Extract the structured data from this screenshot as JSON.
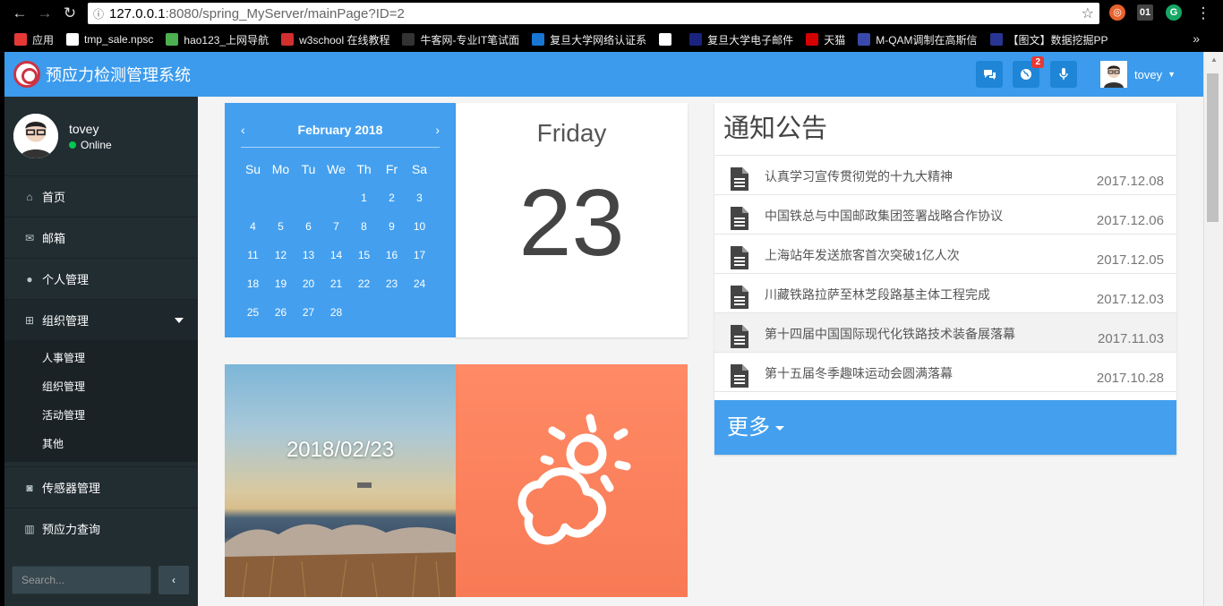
{
  "browser": {
    "url_host": "127.0.0.1",
    "url_rest": ":8080/spring_MyServer/mainPage?ID=2",
    "bookmarks": [
      {
        "label": "应用",
        "color": "#e53935"
      },
      {
        "label": "tmp_sale.npsc",
        "color": "#ffffff"
      },
      {
        "label": "hao123_上网导航",
        "color": "#4caf50"
      },
      {
        "label": "w3school 在线教程",
        "color": "#d32f2f"
      },
      {
        "label": "牛客网-专业IT笔试面",
        "color": "#333333"
      },
      {
        "label": "复旦大学网络认证系",
        "color": "#1976d2"
      },
      {
        "label": "",
        "color": "#ffffff"
      },
      {
        "label": "复旦大学电子邮件",
        "color": "#1a237e"
      },
      {
        "label": "天猫",
        "color": "#d50000"
      },
      {
        "label": "M-QAM调制在高斯信",
        "color": "#3949ab"
      },
      {
        "label": "【图文】数据挖掘PP",
        "color": "#283593"
      }
    ],
    "more_bookmarks": "»"
  },
  "app": {
    "brand": "预应力检测管理系统",
    "header_user": "tovey",
    "notification_count": "2",
    "icons": [
      "comments-icon",
      "globe-icon",
      "microphone-icon"
    ]
  },
  "sidebar": {
    "user_name": "tovey",
    "user_status": "Online",
    "items": [
      {
        "label": "首页",
        "icon": "home-icon"
      },
      {
        "label": "邮箱",
        "icon": "envelope-icon"
      },
      {
        "label": "个人管理",
        "icon": "user-icon"
      },
      {
        "label": "组织管理",
        "icon": "sitemap-icon"
      },
      {
        "label": "传感器管理",
        "icon": "rss-icon"
      },
      {
        "label": "预应力查询",
        "icon": "bar-chart-icon"
      }
    ],
    "submenu": [
      "人事管理",
      "组织管理",
      "活动管理",
      "其他"
    ],
    "search_placeholder": "Search...",
    "collapse_label": "‹"
  },
  "calendar": {
    "month_title": "February 2018",
    "prev": "‹",
    "next": "›",
    "weekdays": [
      "Su",
      "Mo",
      "Tu",
      "We",
      "Th",
      "Fr",
      "Sa"
    ],
    "weeks": [
      [
        "",
        "",
        "",
        "",
        "1",
        "2",
        "3"
      ],
      [
        "4",
        "5",
        "6",
        "7",
        "8",
        "9",
        "10"
      ],
      [
        "11",
        "12",
        "13",
        "14",
        "15",
        "16",
        "17"
      ],
      [
        "18",
        "19",
        "20",
        "21",
        "22",
        "23",
        "24"
      ],
      [
        "25",
        "26",
        "27",
        "28",
        "",
        "",
        ""
      ]
    ]
  },
  "day_card": {
    "weekday": "Friday",
    "day": "23"
  },
  "photo_card": {
    "date": "2018/02/23"
  },
  "weather": {
    "icon": "partly-cloudy-icon"
  },
  "notice": {
    "title": "通知公告",
    "items": [
      {
        "title": "认真学习宣传贯彻党的十九大精神",
        "date": "2017.12.08"
      },
      {
        "title": "中国铁总与中国邮政集团签署战略合作协议",
        "date": "2017.12.06"
      },
      {
        "title": "上海站年发送旅客首次突破1亿人次",
        "date": "2017.12.05"
      },
      {
        "title": "川藏铁路拉萨至林芝段路基主体工程完成",
        "date": "2017.12.03"
      },
      {
        "title": "第十四届中国国际现代化铁路技术装备展落幕",
        "date": "2017.11.03"
      },
      {
        "title": "第十五届冬季趣味运动会圆满落幕",
        "date": "2017.10.28"
      }
    ],
    "more_label": "更多"
  }
}
